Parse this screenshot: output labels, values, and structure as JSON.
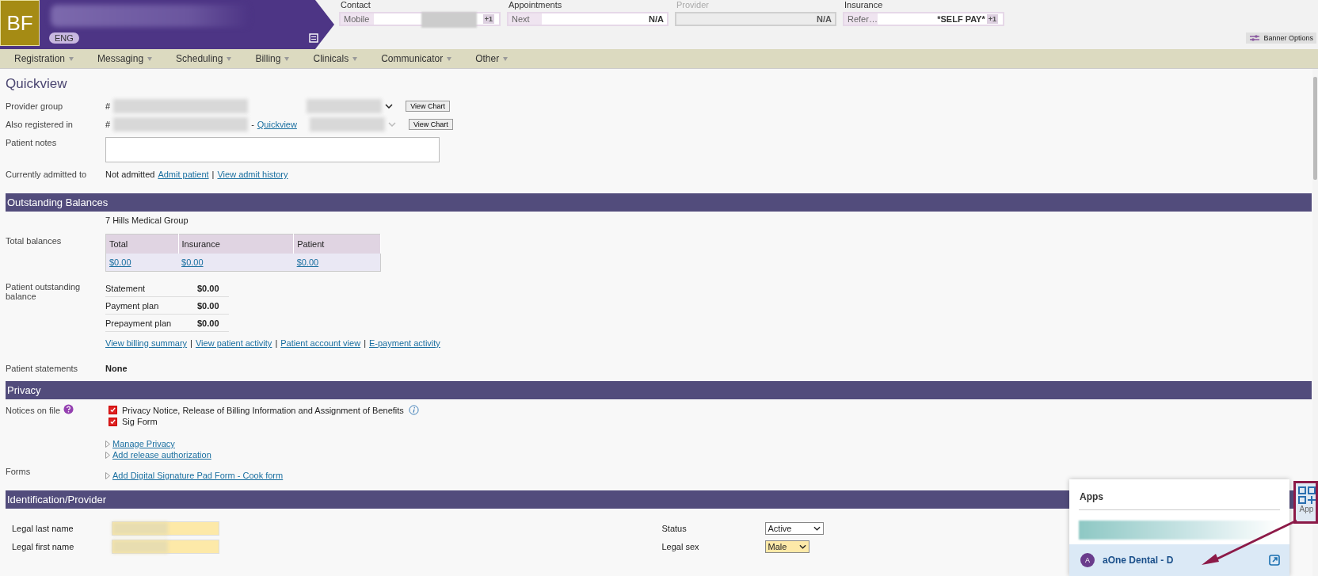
{
  "banner": {
    "initials": "BF",
    "language": "ENG",
    "options_button": "Banner Options",
    "fields": [
      {
        "heading": "Contact",
        "label": "Mobile",
        "badge": "+1",
        "disabled": false
      },
      {
        "heading": "Appointments",
        "label": "Next",
        "value": "N/A",
        "disabled": false
      },
      {
        "heading": "Provider",
        "value": "N/A",
        "disabled": true
      },
      {
        "heading": "Insurance",
        "label": "Refer…",
        "value": "*SELF PAY*",
        "badge": "+1",
        "disabled": false
      }
    ]
  },
  "menu": [
    {
      "label": "Registration"
    },
    {
      "label": "Messaging"
    },
    {
      "label": "Scheduling"
    },
    {
      "label": "Billing"
    },
    {
      "label": "Clinicals"
    },
    {
      "label": "Communicator"
    },
    {
      "label": "Other"
    }
  ],
  "quickview": {
    "title": "Quickview",
    "rows": [
      {
        "label": "Provider group",
        "prefix": "#",
        "button": "View Chart"
      },
      {
        "label": "Also registered in",
        "prefix": "#",
        "dash": "-",
        "link": "Quickview",
        "button": "View Chart"
      }
    ],
    "notes_label": "Patient notes",
    "admitted": {
      "label": "Currently admitted to",
      "value": "Not admitted",
      "separator": "|",
      "links": [
        "Admit patient",
        "View admit history"
      ]
    }
  },
  "outstanding_balances": {
    "title": "Outstanding Balances",
    "group": "7 Hills Medical Group",
    "total_label": "Total balances",
    "table": {
      "columns": [
        "Total",
        "Insurance",
        "Patient"
      ],
      "rows": [
        [
          "$0.00",
          "$0.00",
          "$0.00"
        ]
      ]
    },
    "outstanding_label": "Patient outstanding balance",
    "outstanding_rows": [
      {
        "name": "Statement",
        "amount": "$0.00"
      },
      {
        "name": "Payment plan",
        "amount": "$0.00"
      },
      {
        "name": "Prepayment plan",
        "amount": "$0.00"
      }
    ],
    "link_separator": "|",
    "links": [
      "View billing summary",
      "View patient activity",
      "Patient account view",
      "E-payment activity"
    ],
    "statements_label": "Patient statements",
    "statements_value": "None"
  },
  "privacy": {
    "title": "Privacy",
    "notices_label": "Notices on file",
    "notices": [
      {
        "label": "Privacy Notice, Release of Billing Information and Assignment of Benefits",
        "checked": true,
        "info": true
      },
      {
        "label": "Sig Form",
        "checked": true,
        "info": false
      }
    ],
    "links": [
      "Manage Privacy",
      "Add release authorization"
    ],
    "forms_label": "Forms",
    "form_links": [
      "Add Digital Signature Pad Form - Cook form"
    ]
  },
  "identification": {
    "title": "Identification/Provider",
    "left_fields": [
      {
        "label": "Legal last name",
        "highlighted": true
      },
      {
        "label": "Legal first name",
        "highlighted": true
      }
    ],
    "right_fields": [
      {
        "label": "Status",
        "value": "Active",
        "highlighted": false
      },
      {
        "label": "Legal sex",
        "value": "Male",
        "highlighted": true
      }
    ]
  },
  "apps_panel": {
    "title": "Apps",
    "items": [
      {
        "initial": "A",
        "name": "aOne Dental - D",
        "selected": true
      }
    ]
  },
  "apps_button": {
    "label": "App"
  }
}
